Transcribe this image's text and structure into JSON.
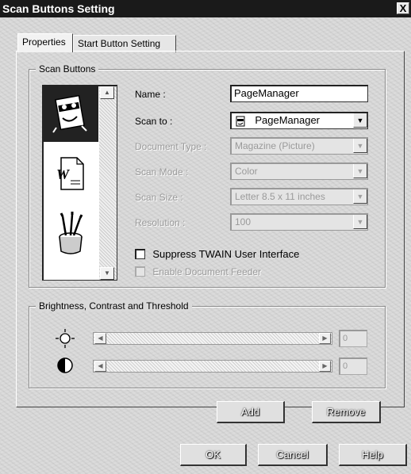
{
  "window": {
    "title": "Scan Buttons Setting",
    "close_label": "X"
  },
  "tabs": [
    {
      "label": "Properties"
    },
    {
      "label": "Start Button Setting"
    }
  ],
  "scan_buttons": {
    "group_label": "Scan Buttons",
    "list_items": [
      {
        "icon": "pagemanager-icon",
        "selected": true
      },
      {
        "icon": "word-document-icon",
        "selected": false
      },
      {
        "icon": "paint-bucket-icon",
        "selected": false
      }
    ]
  },
  "fields": {
    "name_label": "Name :",
    "name_value": "PageManager",
    "scan_to_label": "Scan to :",
    "scan_to_value": "PageManager",
    "document_type_label": "Document Type :",
    "document_type_value": "Magazine (Picture)",
    "scan_mode_label": "Scan Mode :",
    "scan_mode_value": "Color",
    "scan_size_label": "Scan Size :",
    "scan_size_value": "Letter 8.5 x 11 inches",
    "resolution_label": "Resolution :",
    "resolution_value": "100"
  },
  "checkboxes": {
    "suppress_twain_label": "Suppress TWAIN User Interface",
    "suppress_twain_checked": false,
    "enable_feeder_label": "Enable Document Feeder",
    "enable_feeder_checked": false
  },
  "brightness": {
    "group_label": "Brightness, Contrast and Threshold",
    "brightness_value": "0",
    "contrast_value": "0"
  },
  "buttons": {
    "add": "Add",
    "remove": "Remove",
    "ok": "OK",
    "cancel": "Cancel",
    "help": "Help"
  }
}
